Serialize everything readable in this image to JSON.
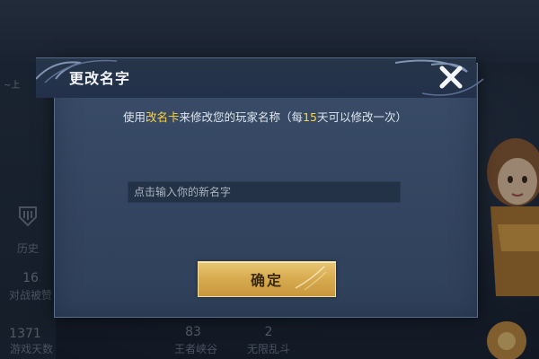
{
  "background": {
    "player_mark": "~上",
    "history_label": "历史",
    "stats": [
      {
        "value": "16",
        "label": "对战被赞"
      },
      {
        "value": "1371",
        "label": "游戏天数"
      },
      {
        "value": "83",
        "label": "王者峡谷"
      },
      {
        "value": "2",
        "label": "无限乱斗"
      }
    ]
  },
  "modal": {
    "title": "更改名字",
    "instruction": {
      "part1": "使用",
      "highlight1": "改名卡",
      "part2": "来修改您的玩家名称（每",
      "highlight2": "15",
      "part3": "天可以修改一次）"
    },
    "input_placeholder": "点击输入你的新名字",
    "input_value": "",
    "confirm_label": "确定",
    "accent_color": "#ffd440",
    "button_color": "#d9ad52"
  }
}
